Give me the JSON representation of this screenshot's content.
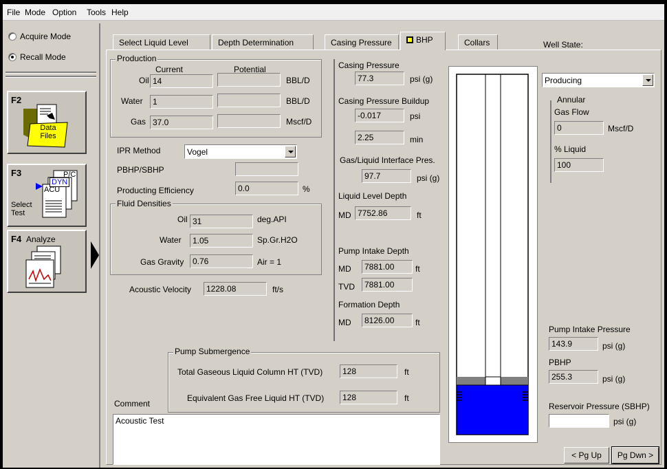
{
  "menu": [
    "File",
    "Mode",
    "Option",
    "Tools",
    "Help"
  ],
  "left": {
    "acquire_mode": "Acquire Mode",
    "recall_mode": "Recall Mode",
    "f2": {
      "key": "F2",
      "label": "Data Files"
    },
    "f3": {
      "key": "F3",
      "label": "Select Test",
      "doc_labels": [
        "P/C",
        "DYN",
        "ACU"
      ]
    },
    "f4": {
      "key": "F4",
      "label": "Analyze"
    }
  },
  "tabs": [
    "Select Liquid Level",
    "Depth Determination",
    "Casing Pressure",
    "BHP",
    "Collars"
  ],
  "production": {
    "title": "Production",
    "col_current": "Current",
    "col_potential": "Potential",
    "rows": [
      {
        "label": "Oil",
        "current": "14",
        "potential": "",
        "unit": "BBL/D"
      },
      {
        "label": "Water",
        "current": "1",
        "potential": "",
        "unit": "BBL/D"
      },
      {
        "label": "Gas",
        "current": "37.0",
        "potential": "",
        "unit": "Mscf/D"
      }
    ]
  },
  "ipr": {
    "label": "IPR Method",
    "value": "Vogel"
  },
  "pbhp_sbhp": {
    "label": "PBHP/SBHP",
    "value": ""
  },
  "efficiency": {
    "label": "Producting Efficiency",
    "value": "0.0",
    "unit": "%"
  },
  "fluid": {
    "title": "Fluid Densities",
    "oil": {
      "label": "Oil",
      "value": "31",
      "unit": "deg.API"
    },
    "water": {
      "label": "Water",
      "value": "1.05",
      "unit": "Sp.Gr.H2O"
    },
    "gas": {
      "label": "Gas Gravity",
      "value": "0.76",
      "unit": "Air = 1"
    }
  },
  "acoustic": {
    "label": "Acoustic Velocity",
    "value": "1228.08",
    "unit": "ft/s"
  },
  "casing": {
    "title": "Casing Pressure",
    "value": "77.3",
    "unit": "psi (g)",
    "buildup_title": "Casing Pressure Buildup",
    "buildup_value": "-0.017",
    "buildup_unit": "psi",
    "time_value": "2.25",
    "time_unit": "min",
    "gl_title": "Gas/Liquid Interface Pres.",
    "gl_value": "97.7",
    "gl_unit": "psi (g)"
  },
  "liquid_level": {
    "title": "Liquid Level Depth",
    "md_label": "MD",
    "md_value": "7752.86",
    "unit": "ft"
  },
  "pump_intake": {
    "title": "Pump Intake Depth",
    "md_label": "MD",
    "md_value": "7881.00",
    "tvd_label": "TVD",
    "tvd_value": "7881.00",
    "unit": "ft"
  },
  "formation": {
    "title": "Formation Depth",
    "md_label": "MD",
    "md_value": "8126.00",
    "unit": "ft"
  },
  "well_state": {
    "title": "Well State:",
    "value": "Producing",
    "annular_title": "Annular",
    "gas_flow_label": "Gas Flow",
    "gas_flow_value": "0",
    "gas_flow_unit": "Mscf/D",
    "liquid_label": "% Liquid",
    "liquid_value": "100"
  },
  "pressures": {
    "pip_label": "Pump Intake Pressure",
    "pip_value": "143.9",
    "pip_unit": "psi (g)",
    "pbhp_label": "PBHP",
    "pbhp_value": "255.3",
    "pbhp_unit": "psi (g)",
    "sbhp_label": "Reservoir Pressure (SBHP)",
    "sbhp_value": "",
    "sbhp_unit": "psi (g)"
  },
  "submergence": {
    "title": "Pump Submergence",
    "total_label": "Total Gaseous Liquid Column HT  (TVD)",
    "total_value": "128",
    "total_unit": "ft",
    "free_label": "Equivalent Gas Free Liquid HT  (TVD)",
    "free_value": "128",
    "free_unit": "ft"
  },
  "comment": {
    "label": "Comment",
    "value": "Acoustic Test"
  },
  "buttons": {
    "pg_up": "< Pg Up",
    "pg_dn": "Pg Dwn >"
  },
  "colors": {
    "liquid": "#0000ff",
    "tab_marker": "#ffff00",
    "gas_band": "#808080"
  }
}
